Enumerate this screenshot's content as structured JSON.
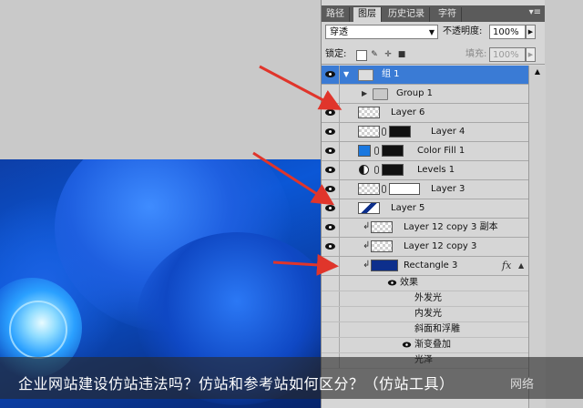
{
  "panel": {
    "tabs": [
      "路径",
      "图层",
      "历史记录",
      "字符"
    ],
    "active_tab": 1,
    "blend_mode": "穿透",
    "opacity_label": "不透明度:",
    "opacity_value": "100%",
    "lock_label": "锁定:",
    "fill_label": "填充:",
    "fill_value": "100%"
  },
  "layers": [
    {
      "name": "组 1",
      "selected": true
    },
    {
      "name": "Group 1"
    },
    {
      "name": "Layer 6"
    },
    {
      "name": "Layer 4"
    },
    {
      "name": "Color Fill 1"
    },
    {
      "name": "Levels 1"
    },
    {
      "name": "Layer 3"
    },
    {
      "name": "Layer 5"
    },
    {
      "name": "Layer 12 copy 3 副本"
    },
    {
      "name": "Layer 12 copy 3"
    },
    {
      "name": "Rectangle 3",
      "fx": "fx"
    },
    {
      "name": "效果"
    },
    {
      "name": "外发光"
    },
    {
      "name": "内发光"
    },
    {
      "name": "斜面和浮雕"
    },
    {
      "name": "渐变叠加"
    },
    {
      "name": "光泽"
    }
  ],
  "caption": "企业网站建设仿站违法吗？仿站和参考站如何区分？（仿站工具）",
  "watermark": "网络",
  "colors": {
    "selection": "#3a7bd5",
    "arrow": "#e0352b",
    "panel_bg": "#d6d6d6"
  },
  "icons": [
    "eye-icon",
    "folder-icon",
    "chain-icon",
    "lock-icon",
    "brush-icon",
    "move-icon",
    "panel-menu-icon"
  ]
}
